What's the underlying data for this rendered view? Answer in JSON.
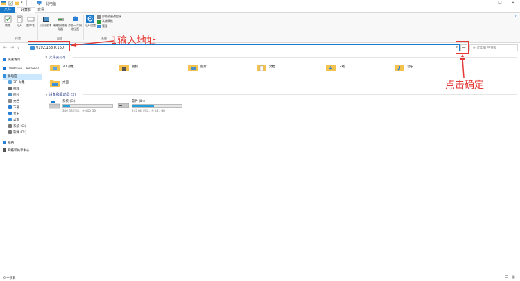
{
  "window": {
    "title": "此电脑",
    "controls": {
      "minimize": "–",
      "maximize": "☐",
      "close": "✕"
    }
  },
  "ribbon_tabs": [
    "文件",
    "计算机",
    "查看"
  ],
  "ribbon": {
    "buttons": [
      {
        "label": "属性",
        "icon": "properties-icon"
      },
      {
        "label": "打开",
        "icon": "open-icon"
      },
      {
        "label": "重命名",
        "icon": "rename-icon"
      },
      {
        "label": "访问媒体",
        "icon": "media-icon"
      },
      {
        "label": "映射网络驱动器",
        "icon": "map-drive-icon"
      },
      {
        "label": "添加一个网络位置",
        "icon": "network-location-icon"
      },
      {
        "label": "打开设置",
        "icon": "settings-icon"
      }
    ],
    "system_items": [
      {
        "label": "卸载或更改程序",
        "icon": "uninstall-icon"
      },
      {
        "label": "系统属性",
        "icon": "system-properties-icon"
      },
      {
        "label": "管理",
        "icon": "manage-icon"
      }
    ],
    "groups": [
      "位置",
      "网络",
      "系统"
    ]
  },
  "address": {
    "value": "\\\\192.168.0.160",
    "go_label": "→",
    "search_placeholder": "在 此电脑 中搜索"
  },
  "annotations": {
    "address_note": "1输入地址",
    "go_note": "点击确定"
  },
  "sidebar": {
    "items": [
      {
        "label": "快速访问",
        "icon": "star-icon",
        "color": "#2b7fd4",
        "level": 0
      },
      {
        "label": "OneDrive - Personal",
        "icon": "cloud-icon",
        "color": "#1a6fcf",
        "level": 0
      },
      {
        "label": "此电脑",
        "icon": "computer-icon",
        "color": "#3b8fd8",
        "level": 0,
        "selected": true
      },
      {
        "label": "3D 对象",
        "icon": "3d-objects-icon",
        "color": "#5aa4e0",
        "level": 1
      },
      {
        "label": "视频",
        "icon": "video-icon",
        "color": "#6b6b6b",
        "level": 1
      },
      {
        "label": "图片",
        "icon": "picture-icon",
        "color": "#4a90c8",
        "level": 1
      },
      {
        "label": "文档",
        "icon": "document-icon",
        "color": "#8a8a8a",
        "level": 1
      },
      {
        "label": "下载",
        "icon": "download-icon",
        "color": "#2b7fd4",
        "level": 1
      },
      {
        "label": "音乐",
        "icon": "music-icon",
        "color": "#2b7fd4",
        "level": 1
      },
      {
        "label": "桌面",
        "icon": "desktop-icon",
        "color": "#3b8fd8",
        "level": 1
      },
      {
        "label": "系统 (C:)",
        "icon": "drive-icon",
        "color": "#777777",
        "level": 1
      },
      {
        "label": "软件 (D:)",
        "icon": "drive-icon",
        "color": "#777777",
        "level": 1
      },
      {
        "label": "网络",
        "icon": "network-icon",
        "color": "#2b7fd4",
        "level": 0
      },
      {
        "label": "网络和共享中心",
        "icon": "share-center-icon",
        "color": "#555555",
        "level": 0
      }
    ]
  },
  "folders_section": {
    "title": "文件夹 (7)",
    "items": [
      {
        "label": "3D 对象",
        "icon": "3d-objects-folder-icon",
        "accent": "#5aa4e0"
      },
      {
        "label": "视频",
        "icon": "video-folder-icon",
        "accent": "#555555"
      },
      {
        "label": "图片",
        "icon": "picture-folder-icon",
        "accent": "#4a90c8"
      },
      {
        "label": "文档",
        "icon": "document-folder-icon",
        "accent": "#9a9a9a"
      },
      {
        "label": "下载",
        "icon": "download-folder-icon",
        "accent": "#2b7fd4"
      },
      {
        "label": "音乐",
        "icon": "music-folder-icon",
        "accent": "#2b7fd4"
      },
      {
        "label": "桌面",
        "icon": "desktop-folder-icon",
        "accent": "#3b8fd8"
      }
    ]
  },
  "drives_section": {
    "title": "设备和驱动器 (2)",
    "items": [
      {
        "label": "系统 (C:)",
        "free_text": "346 GB 可用，共 400 GB",
        "used_fraction": 0.14,
        "icon": "windows-drive-icon"
      },
      {
        "label": "软件 (D:)",
        "free_text": "245 GB 可用，共 431 GB",
        "used_fraction": 0.43,
        "icon": "drive-icon"
      }
    ]
  },
  "status": {
    "count": "9 个项目"
  },
  "colors": {
    "accent": "#1979ca",
    "annotation": "#e53935",
    "folder": "#f4c34f"
  }
}
